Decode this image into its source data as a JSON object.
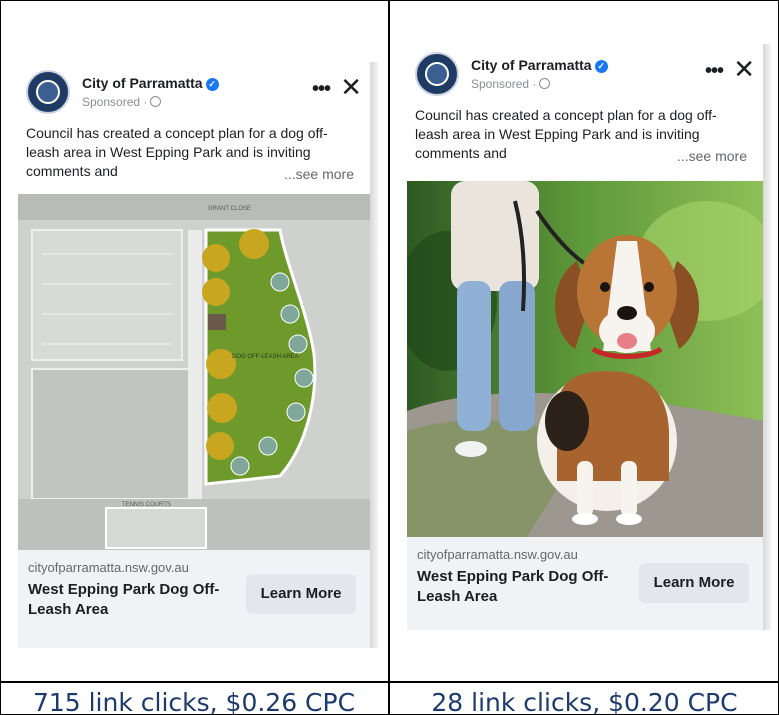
{
  "ads": [
    {
      "page_name": "City of Parramatta",
      "sponsored": "Sponsored ·",
      "body": "Council has created a concept plan for a dog off-leash area in West Epping Park and is inviting comments and",
      "see_more": "...see more",
      "domain": "cityofparramatta.nsw.gov.au",
      "headline": "West Epping Park Dog Off-Leash Area",
      "cta": "Learn More",
      "map_labels": {
        "street": "GRANT CLOSE",
        "area": "DOG OFF-LEASH AREA",
        "courts": "TENNIS COURTS"
      }
    },
    {
      "page_name": "City of Parramatta",
      "sponsored": "Sponsored ·",
      "body": "Council has created a concept plan for a dog off-leash area in West Epping Park and is inviting comments and",
      "see_more": "...see more",
      "domain": "cityofparramatta.nsw.gov.au",
      "headline": "West Epping Park Dog Off-Leash Area",
      "cta": "Learn More"
    }
  ],
  "captions": [
    "715 link clicks, $0.26 CPC",
    "28 link clicks, $0.20 CPC"
  ],
  "icons": {
    "verified": "verified-badge-icon",
    "globe": "globe-icon",
    "more": "more-options-icon",
    "close": "close-icon"
  },
  "colors": {
    "caption": "#1d3a6e",
    "verified": "#1877f2",
    "footer_bg": "#f0f2f5",
    "park_green": "#6e9a2c"
  }
}
